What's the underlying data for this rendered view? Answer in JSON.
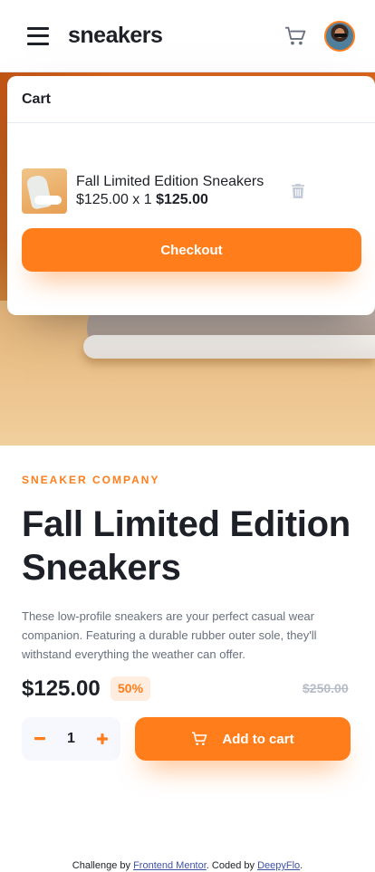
{
  "header": {
    "logo": "sneakers"
  },
  "cart": {
    "title": "Cart",
    "item": {
      "name": "Fall Limited Edition Sneakers",
      "unit_price": "$125.00 x 1",
      "total": "$125.00"
    },
    "checkout_label": "Checkout"
  },
  "product": {
    "company": "SNEAKER COMPANY",
    "title": "Fall Limited Edition Sneakers",
    "description": "These low-profile sneakers are your perfect casual wear companion. Featuring a durable rubber outer sole, they'll withstand everything the weather can offer.",
    "price": "$125.00",
    "discount": "50%",
    "old_price": "$250.00",
    "quantity": "1",
    "add_to_cart_label": "Add to cart"
  },
  "footer": {
    "prefix": "Challenge by ",
    "link1": "Frontend Mentor",
    "middle": ". Coded by ",
    "link2": "DeepyFlo",
    "suffix": "."
  },
  "colors": {
    "accent": "#ff7e1b",
    "accent_pale": "#ffede0",
    "text_dark": "#1d2026",
    "text_gray": "#68707d",
    "muted": "#b6bcc8"
  },
  "icons": [
    "menu-icon",
    "cart-icon",
    "avatar",
    "trash-icon",
    "minus-icon",
    "plus-icon"
  ]
}
